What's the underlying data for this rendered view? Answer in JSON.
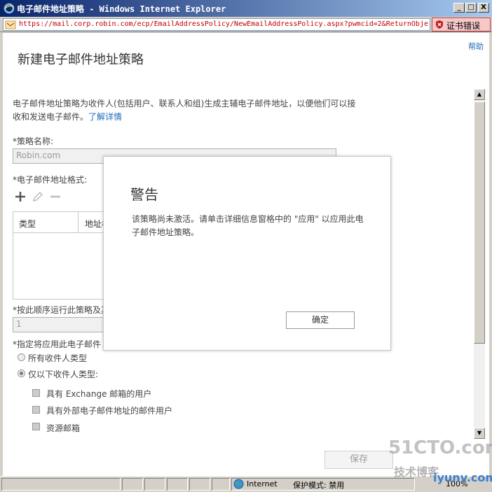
{
  "window": {
    "title": "电子邮件地址策略 - Windows Internet Explorer",
    "minimize": "_",
    "restore": "□",
    "close": "X"
  },
  "address_bar": {
    "url": "https://mail.corp.robin.com/ecp/EmailAddressPolicy/NewEmailAddressPolicy.aspx?pwmcid=2&ReturnObje",
    "cert_error_label": "证书错误"
  },
  "page": {
    "help_label": "帮助",
    "title": "新建电子邮件地址策略",
    "description": "电子邮件地址策略为收件人(包括用户、联系人和组)生成主辅电子邮件地址，以便他们可以接收和发送电子邮件。",
    "learn_more": "了解详情",
    "policy_name_label": "*策略名称:",
    "policy_name_value": "Robin.com",
    "email_format_label": "*电子邮件地址格式:",
    "grid_columns": [
      "类型",
      "地址格"
    ],
    "run_order_label": "*按此顺序运行此策略及其",
    "run_order_value": "1",
    "apply_to_label": "*指定将应用此电子邮件",
    "radio_all": "所有收件人类型",
    "radio_following": "仅以下收件人类型:",
    "checkbox_exchange": "具有 Exchange 邮箱的用户",
    "checkbox_external": "具有外部电子邮件地址的邮件用户",
    "checkbox_resource": "资源邮箱",
    "save_label": "保存"
  },
  "dialog": {
    "title": "警告",
    "message": "该策略尚未激活。请单击详细信息窗格中的 \"应用\" 以应用此电子邮件地址策略。",
    "ok_label": "确定"
  },
  "status_bar": {
    "zone": "Internet",
    "protected_mode": "保护模式: 禁用",
    "zoom": "100%"
  },
  "watermark": {
    "logo": "51CTO.com",
    "tagline": "技术博客",
    "site": "iyunv.com"
  },
  "colors": {
    "accent_link": "#1e6bb8",
    "titlebar_start": "#0a246a",
    "cert_error_bg": "#f6c8c8"
  }
}
